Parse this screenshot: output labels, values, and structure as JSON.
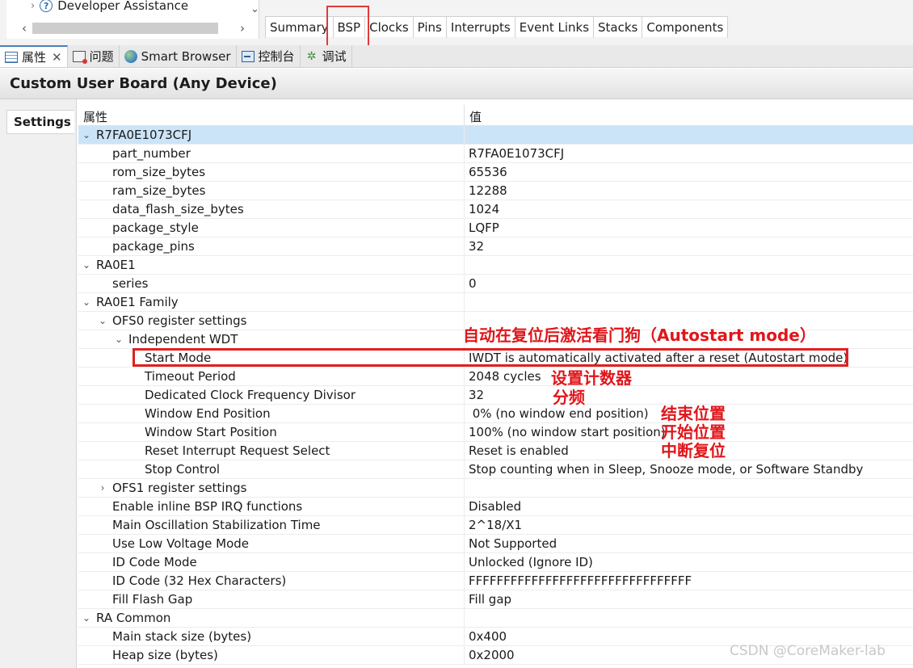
{
  "tree": {
    "item_label": "Developer Assistance"
  },
  "bsp_tabs": [
    "Summary",
    "BSP",
    "Clocks",
    "Pins",
    "Interrupts",
    "Event Links",
    "Stacks",
    "Components"
  ],
  "view_tabs": [
    {
      "label": "属性",
      "icon": "properties-icon",
      "closable": true
    },
    {
      "label": "问题",
      "icon": "problems-icon"
    },
    {
      "label": "Smart Browser",
      "icon": "smart-browser-icon"
    },
    {
      "label": "控制台",
      "icon": "console-icon"
    },
    {
      "label": "调试",
      "icon": "debug-icon"
    }
  ],
  "page_title": "Custom User Board (Any Device)",
  "left_tab": "Settings",
  "table": {
    "header_property": "属性",
    "header_value": "值",
    "rows": [
      {
        "label": "R7FA0E1073CFJ",
        "value": "",
        "level": 0,
        "twisty": "open",
        "selected": true
      },
      {
        "label": "part_number",
        "value": "R7FA0E1073CFJ",
        "level": 2
      },
      {
        "label": "rom_size_bytes",
        "value": "65536",
        "level": 2
      },
      {
        "label": "ram_size_bytes",
        "value": "12288",
        "level": 2
      },
      {
        "label": "data_flash_size_bytes",
        "value": "1024",
        "level": 2
      },
      {
        "label": "package_style",
        "value": "LQFP",
        "level": 2
      },
      {
        "label": "package_pins",
        "value": "32",
        "level": 2
      },
      {
        "label": "RA0E1",
        "value": "",
        "level": 0,
        "twisty": "open"
      },
      {
        "label": "series",
        "value": "0",
        "level": 2
      },
      {
        "label": "RA0E1 Family",
        "value": "",
        "level": 0,
        "twisty": "open"
      },
      {
        "label": "OFS0 register settings",
        "value": "",
        "level": 1,
        "twisty": "open"
      },
      {
        "label": "Independent WDT",
        "value": "",
        "level": 2,
        "twisty": "open"
      },
      {
        "label": "Start Mode",
        "value": "IWDT is automatically activated after a reset (Autostart mode)",
        "level": 4
      },
      {
        "label": "Timeout Period",
        "value": "2048 cycles",
        "level": 4
      },
      {
        "label": "Dedicated Clock Frequency Divisor",
        "value": "32",
        "level": 4
      },
      {
        "label": "Window End Position",
        "value": " 0% (no window end position)",
        "level": 4
      },
      {
        "label": "Window Start Position",
        "value": "100% (no window start position)",
        "level": 4
      },
      {
        "label": "Reset Interrupt Request Select",
        "value": "Reset is enabled",
        "level": 4
      },
      {
        "label": "Stop Control",
        "value": "Stop counting when in Sleep, Snooze mode, or Software Standby",
        "level": 4
      },
      {
        "label": "OFS1 register settings",
        "value": "",
        "level": 1,
        "twisty": "closed"
      },
      {
        "label": "Enable inline BSP IRQ functions",
        "value": "Disabled",
        "level": 2
      },
      {
        "label": "Main Oscillation Stabilization Time",
        "value": "2^18/X1",
        "level": 2
      },
      {
        "label": "Use Low Voltage Mode",
        "value": "Not Supported",
        "level": 2
      },
      {
        "label": "ID Code Mode",
        "value": "Unlocked (Ignore ID)",
        "level": 2
      },
      {
        "label": "ID Code (32 Hex Characters)",
        "value": "FFFFFFFFFFFFFFFFFFFFFFFFFFFFFFFF",
        "level": 2
      },
      {
        "label": "Fill Flash Gap",
        "value": "Fill gap",
        "level": 2
      },
      {
        "label": "RA Common",
        "value": "",
        "level": 0,
        "twisty": "open"
      },
      {
        "label": "Main stack size (bytes)",
        "value": "0x400",
        "level": 2
      },
      {
        "label": "Heap size (bytes)",
        "value": "0x2000",
        "level": 2
      }
    ]
  },
  "annotations": {
    "autostart": "自动在复位后激活看门狗（Autostart mode）",
    "counter_line1": "设置计数器",
    "counter_line2": "分频",
    "window_end": "结束位置",
    "window_start": "开始位置",
    "interrupt_reset": "中断复位"
  },
  "watermark": "CSDN @CoreMaker-lab",
  "colors": {
    "annotation": "#e0161b",
    "selection": "#cce4f7"
  }
}
